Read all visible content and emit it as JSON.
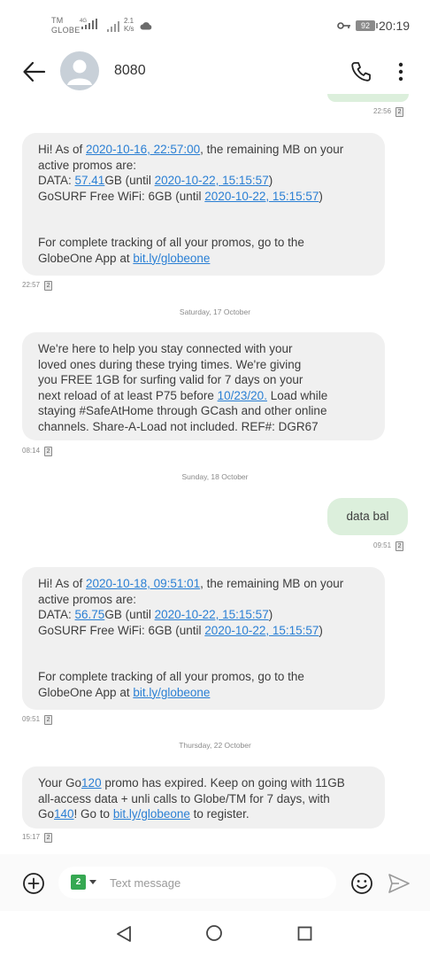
{
  "status_bar": {
    "carrier_tm": "TM",
    "carrier_globe": "GLOBE",
    "network_4g": "4G",
    "speed_value": "2.1",
    "speed_unit": "K/s",
    "battery": "92",
    "time": "20:19"
  },
  "header": {
    "contact": "8080"
  },
  "thread": {
    "top_meta_time": "22:56",
    "sim_slot": "2",
    "messages": [
      {
        "time": "22:57",
        "p1": "Hi! As of ",
        "l1": "2020-10-16, 22:57:00",
        "p2": ", the remaining MB on your\nactive promos are:\nDATA: ",
        "l2": "57.41",
        "p3": "GB (until ",
        "l3": "2020-10-22, 15:15:57",
        "p4": ")\nGoSURF Free WiFi: 6GB (until ",
        "l4": "2020-10-22, 15:15:57",
        "p5": ")\n\n\nFor complete tracking of all your promos, go to the\nGlobeOne App at ",
        "l5": "bit.ly/globeone"
      },
      {
        "date": "Saturday, 17 October",
        "time": "08:14",
        "p1": "We're here to help you stay connected with your\nloved ones during these trying times. We're giving\nyou FREE 1GB for surfing valid for 7 days on your\nnext reload of at least P75 before ",
        "l1": "10/23/20.",
        "p2": " Load while\nstaying #SafeAtHome through GCash and other online\nchannels. Share-A-Load not included. REF#: DGR67"
      },
      {
        "date": "Sunday, 18 October",
        "time": "09:51",
        "text": "data bal"
      },
      {
        "time": "09:51",
        "p1": "Hi! As of ",
        "l1": "2020-10-18, 09:51:01",
        "p2": ", the remaining MB on your\nactive promos are:\nDATA: ",
        "l2": "56.75",
        "p3": "GB (until ",
        "l3": "2020-10-22, 15:15:57",
        "p4": ")\nGoSURF Free WiFi: 6GB (until ",
        "l4": "2020-10-22, 15:15:57",
        "p5": ")\n\n\nFor complete tracking of all your promos, go to the\nGlobeOne App at ",
        "l5": "bit.ly/globeone"
      },
      {
        "date": "Thursday, 22 October",
        "time": "15:17",
        "p1": "Your Go",
        "l1": "120",
        "p2": " promo has expired. Keep on going with 11GB\nall-access data + unli calls to Globe/TM for 7 days, with\nGo",
        "l2": "140",
        "p3": "! Go to ",
        "l3": "bit.ly/globeone",
        "p4": " to register."
      }
    ]
  },
  "composer": {
    "sim_label": "2",
    "placeholder": "Text message"
  },
  "icons": {
    "back": "arrow-left-icon",
    "call": "phone-icon",
    "more": "more-vertical-icon",
    "add": "plus-circle-icon",
    "emoji": "smiley-icon",
    "send": "send-icon"
  }
}
